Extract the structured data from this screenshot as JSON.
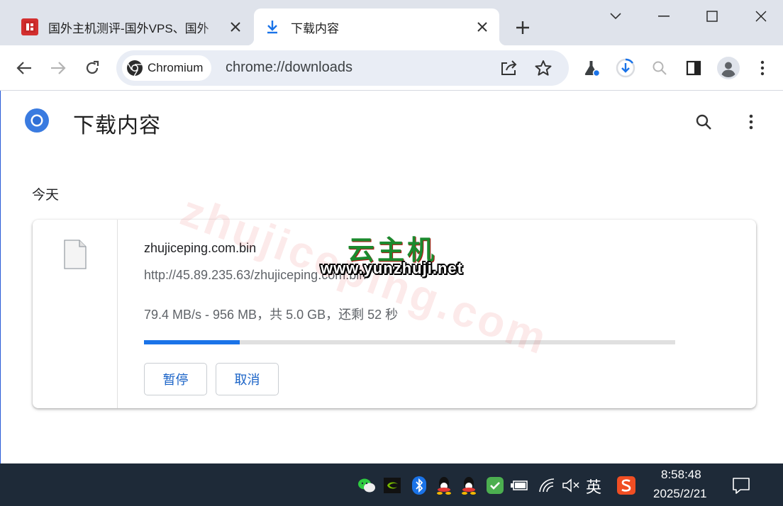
{
  "tabs": [
    {
      "title": "国外主机测评-国外VPS、国外",
      "favicon": "site-logo-icon",
      "active": false
    },
    {
      "title": "下载内容",
      "favicon": "download-icon",
      "active": true
    }
  ],
  "toolbar": {
    "chip_label": "Chromium",
    "url": "chrome://downloads"
  },
  "page": {
    "title": "下载内容",
    "section": "今天"
  },
  "download": {
    "filename": "zhujiceping.com.bin",
    "url": "http://45.89.235.63/zhujiceping.com.bin",
    "status": "79.4 MB/s - 956 MB，共 5.0 GB，还剩 52 秒",
    "progress_percent": 18,
    "pause_label": "暂停",
    "cancel_label": "取消"
  },
  "watermark": {
    "big": "zhujiceping.com",
    "logo_cn": "云主机",
    "logo_url": "www.yunzhuji.net"
  },
  "taskbar": {
    "ime": "英",
    "time": "8:58:48",
    "date": "2025/2/21"
  },
  "colors": {
    "accent": "#1a73e8",
    "tabstrip": "#dfe3eb",
    "taskbar": "#1e2a38"
  }
}
